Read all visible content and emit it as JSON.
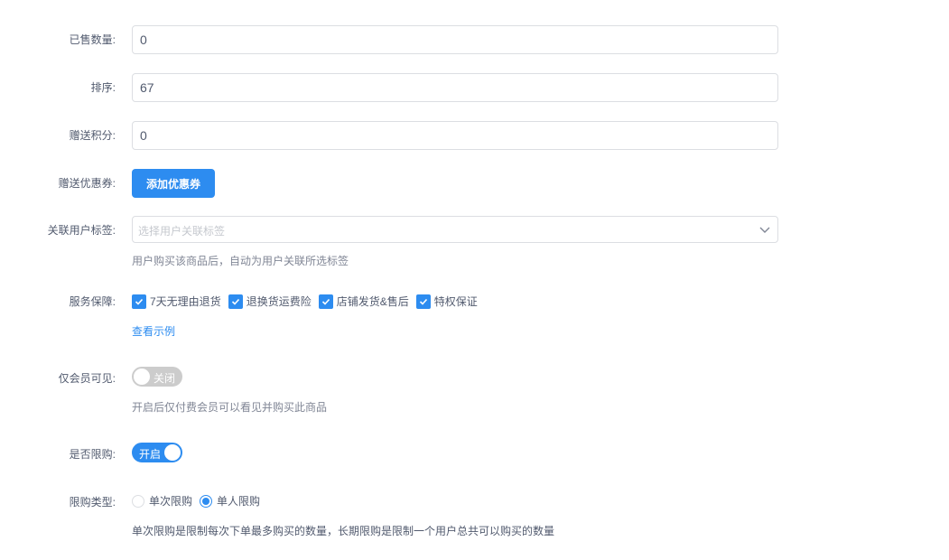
{
  "form": {
    "sold_count": {
      "label": "已售数量:",
      "value": "0"
    },
    "sort": {
      "label": "排序:",
      "value": "67"
    },
    "gift_points": {
      "label": "赠送积分:",
      "value": "0"
    },
    "gift_coupon": {
      "label": "赠送优惠券:",
      "button_label": "添加优惠券"
    },
    "user_tags": {
      "label": "关联用户标签:",
      "placeholder": "选择用户关联标签",
      "help": "用户购买该商品后，自动为用户关联所选标签",
      "icon": "chevron-down-icon"
    },
    "service": {
      "label": "服务保障:",
      "options": [
        {
          "label": "7天无理由退货",
          "checked": true
        },
        {
          "label": "退换货运费险",
          "checked": true
        },
        {
          "label": "店铺发货&售后",
          "checked": true
        },
        {
          "label": "特权保证",
          "checked": true
        }
      ],
      "example_link": "查看示例"
    },
    "member_only": {
      "label": "仅会员可见:",
      "switch_state": "off",
      "switch_text": "关闭",
      "help": "开启后仅付费会员可以看见并购买此商品"
    },
    "purchase_limit": {
      "label": "是否限购:",
      "switch_state": "on",
      "switch_text": "开启"
    },
    "limit_type": {
      "label": "限购类型:",
      "options": [
        {
          "label": "单次限购",
          "checked": false
        },
        {
          "label": "单人限购",
          "checked": true
        }
      ],
      "note": "单次限购是限制每次下单最多购买的数量，长期限购是限制一个用户总共可以购买的数量"
    }
  },
  "colors": {
    "primary": "#2d8cf0",
    "border": "#dcdee2",
    "text": "#515a6e",
    "help_text": "#808695",
    "switch_off": "#cccccc"
  }
}
